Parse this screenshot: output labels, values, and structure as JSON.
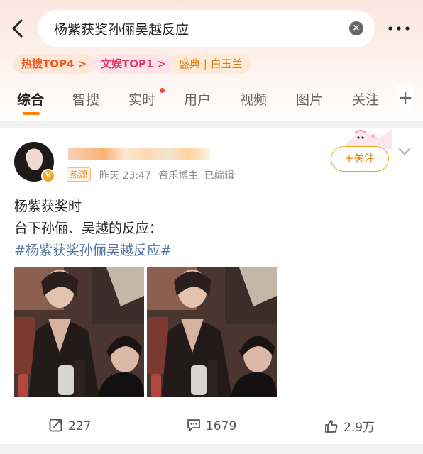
{
  "search": {
    "query": "杨紫获奖孙俪吴越反应"
  },
  "chips": [
    {
      "label": "热搜TOP4 >"
    },
    {
      "label": "文娱TOP1 >"
    },
    {
      "label": "盛典 | 白玉兰"
    }
  ],
  "tabs": [
    {
      "label": "综合"
    },
    {
      "label": "智搜"
    },
    {
      "label": "实时"
    },
    {
      "label": "用户"
    },
    {
      "label": "视频"
    },
    {
      "label": "图片"
    },
    {
      "label": "关注"
    }
  ],
  "post": {
    "tag": "热源",
    "time": "昨天 23:47",
    "source": "音乐博主",
    "edited": "已编辑",
    "follow_label": "+关注",
    "line1": "杨紫获奖时",
    "line2": "台下孙俪、吴越的反应：",
    "hashtag": "#杨紫获奖孙俪吴越反应#",
    "images": 2
  },
  "actions": {
    "repost": "227",
    "comment": "1679",
    "like": "2.9万"
  },
  "colors": {
    "accent": "#ff8200",
    "link": "#4f73a8",
    "hot_chip": "#ef5b1f",
    "ent_chip": "#e6396a"
  }
}
